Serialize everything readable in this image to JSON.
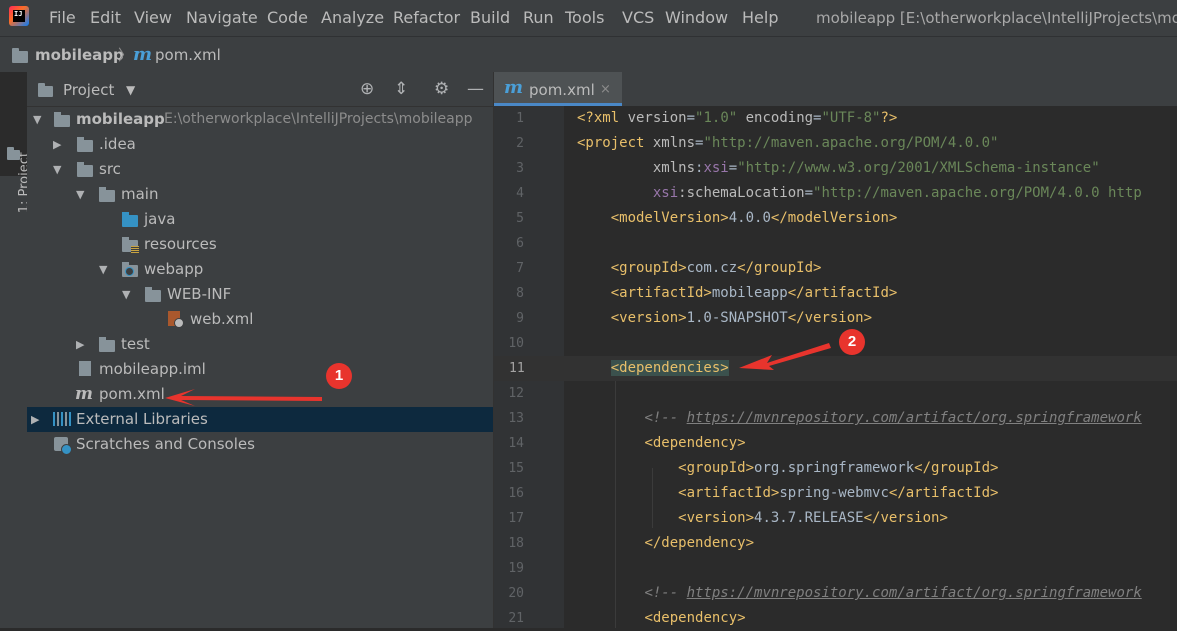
{
  "menu": {
    "items": [
      "File",
      "Edit",
      "View",
      "Navigate",
      "Code",
      "Analyze",
      "Refactor",
      "Build",
      "Run",
      "Tools",
      "VCS",
      "Window",
      "Help"
    ],
    "window_title": "mobileapp [E:\\otherworkplace\\IntelliJProjects\\mo"
  },
  "breadcrumb": {
    "project": "mobileapp",
    "file_icon": "m",
    "file": "pom.xml"
  },
  "side_tab": {
    "label": "1: Project"
  },
  "project_panel": {
    "title": "Project",
    "toolbar_icons": [
      "locate-icon",
      "collapse-all-icon",
      "gear-icon",
      "hide-icon"
    ],
    "tree": [
      {
        "label": "mobileapp",
        "path": "E:\\otherworkplace\\IntelliJProjects\\mobileapp"
      },
      {
        "label": ".idea"
      },
      {
        "label": "src"
      },
      {
        "label": "main"
      },
      {
        "label": "java"
      },
      {
        "label": "resources"
      },
      {
        "label": "webapp"
      },
      {
        "label": "WEB-INF"
      },
      {
        "label": "web.xml"
      },
      {
        "label": "test"
      },
      {
        "label": "mobileapp.iml"
      },
      {
        "label": "pom.xml",
        "icon_text": "m"
      },
      {
        "label": "External Libraries"
      },
      {
        "label": "Scratches and Consoles"
      }
    ]
  },
  "editor": {
    "tab": {
      "icon_text": "m",
      "label": "pom.xml",
      "close": "×"
    },
    "line_numbers": [
      "1",
      "2",
      "3",
      "4",
      "5",
      "6",
      "7",
      "8",
      "9",
      "10",
      "11",
      "12",
      "13",
      "14",
      "15",
      "16",
      "17",
      "18",
      "19",
      "20",
      "21"
    ],
    "current_line": 11,
    "code": {
      "l1": {
        "a": "<?xml ",
        "b": "version",
        "c": "=",
        "d": "\"1.0\"",
        "e": " encoding",
        "f": "=",
        "g": "\"UTF-8\"",
        "h": "?>"
      },
      "l2": {
        "a": "<project ",
        "b": "xmlns",
        "c": "=",
        "d": "\"http://maven.apache.org/POM/4.0.0\""
      },
      "l3": {
        "a": "         xmlns",
        "b": ":",
        "c": "xsi",
        "d": "=",
        "e": "\"http://www.w3.org/2001/XMLSchema-instance\""
      },
      "l4": {
        "a": "         ",
        "b": "xsi",
        "c": ":schemaLocation",
        "d": "=",
        "e": "\"http://maven.apache.org/POM/4.0.0 http"
      },
      "l5": {
        "a": "    ",
        "b": "<modelVersion>",
        "c": "4.0.0",
        "d": "</modelVersion>"
      },
      "l7": {
        "a": "    ",
        "b": "<groupId>",
        "c": "com.cz",
        "d": "</groupId>"
      },
      "l8": {
        "a": "    ",
        "b": "<artifactId>",
        "c": "mobileapp",
        "d": "</artifactId>"
      },
      "l9": {
        "a": "    ",
        "b": "<version>",
        "c": "1.0-SNAPSHOT",
        "d": "</version>"
      },
      "l11": {
        "a": "    ",
        "b": "<dependencies>"
      },
      "l13": {
        "a": "        ",
        "b": "<!-- ",
        "c": "https://mvnrepository.com/artifact/org.springframework"
      },
      "l14": {
        "a": "        ",
        "b": "<dependency>"
      },
      "l15": {
        "a": "            ",
        "b": "<groupId>",
        "c": "org.springframework",
        "d": "</groupId>"
      },
      "l16": {
        "a": "            ",
        "b": "<artifactId>",
        "c": "spring-webmvc",
        "d": "</artifactId>"
      },
      "l17": {
        "a": "            ",
        "b": "<version>",
        "c": "4.3.7.RELEASE",
        "d": "</version>"
      },
      "l18": {
        "a": "        ",
        "b": "</dependency>"
      },
      "l20": {
        "a": "        ",
        "b": "<!-- ",
        "c": "https://mvnrepository.com/artifact/org.springframework"
      },
      "l21": {
        "a": "        ",
        "b": "<dependency>"
      }
    }
  },
  "annotations": {
    "badge1": "1",
    "badge2": "2",
    "color": "#e8342d"
  }
}
